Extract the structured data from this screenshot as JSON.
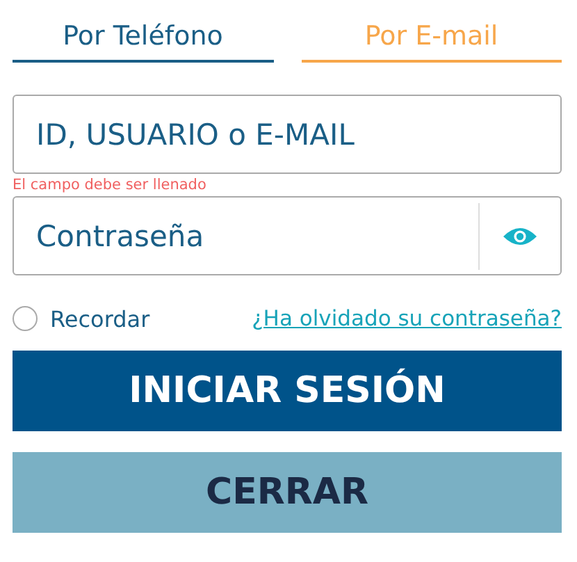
{
  "tabs": [
    {
      "label": "Por Teléfono",
      "selected": true
    },
    {
      "label": "Por E-mail",
      "selected": false
    }
  ],
  "login_field": {
    "placeholder": "ID, USUARIO o E-MAIL",
    "error": "El campo debe ser llenado"
  },
  "password_field": {
    "placeholder": "Contraseña"
  },
  "remember": {
    "label": "Recordar",
    "checked": false
  },
  "forgot_link": "¿Ha olvidado su contraseña?",
  "buttons": [
    {
      "label": "INICIAR SESIÓN",
      "kind": "primary"
    },
    {
      "label": "CERRAR",
      "kind": "secondary"
    }
  ]
}
